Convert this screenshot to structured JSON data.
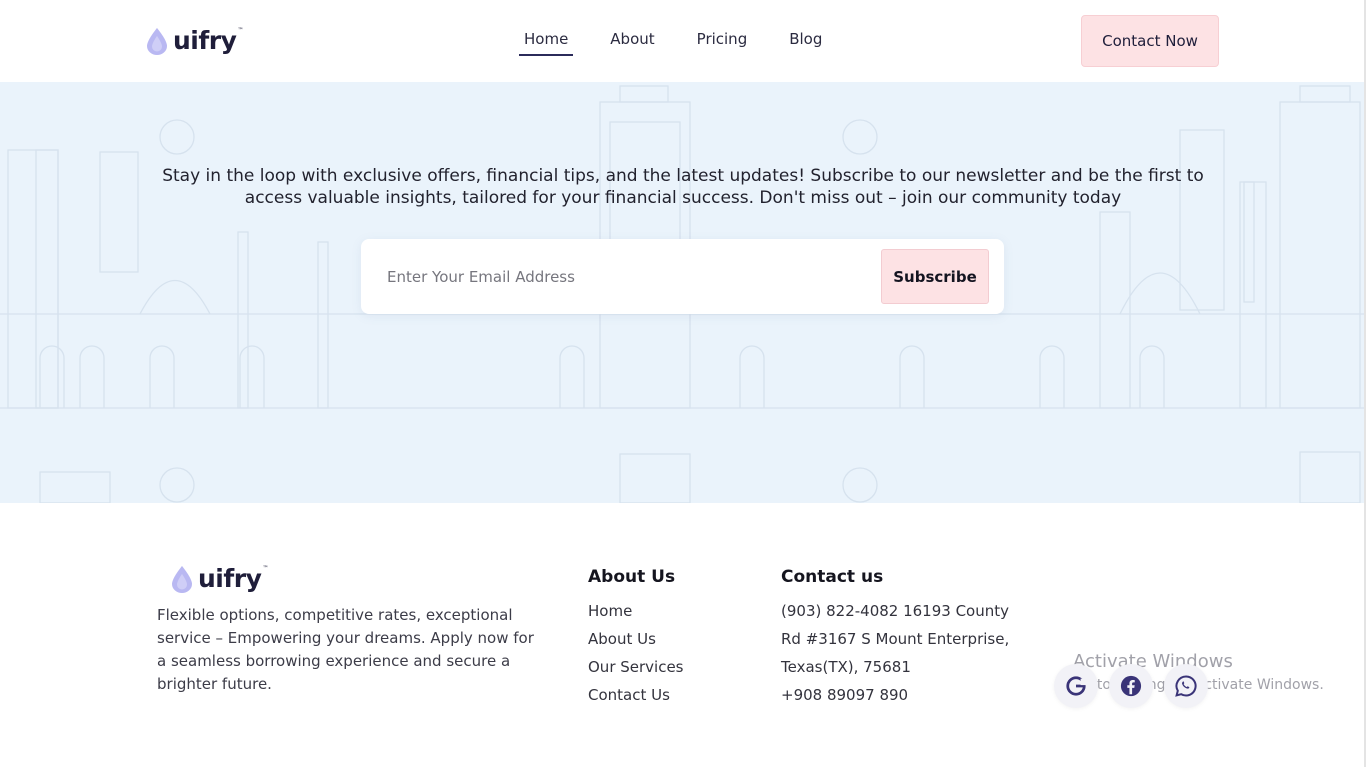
{
  "brand": {
    "name": "uifry",
    "tm": "™"
  },
  "nav": {
    "items": [
      {
        "label": "Home",
        "active": true
      },
      {
        "label": "About",
        "active": false
      },
      {
        "label": "Pricing",
        "active": false
      },
      {
        "label": "Blog",
        "active": false
      }
    ],
    "contact_button": "Contact Now"
  },
  "newsletter": {
    "line1": "Stay in the loop with exclusive offers, financial tips, and the latest updates! Subscribe to our newsletter and be the first to",
    "line2": "access valuable insights, tailored for your financial success. Don't miss out – join our community today",
    "email_placeholder": "Enter Your Email Address",
    "subscribe_label": "Subscribe"
  },
  "footer": {
    "description": "Flexible options, competitive rates, exceptional service – Empowering your dreams. Apply now for a seamless borrowing experience and secure a brighter future.",
    "about": {
      "title": "About Us",
      "links": [
        "Home",
        "About Us",
        "Our Services",
        "Contact Us"
      ]
    },
    "contact": {
      "title": "Contact us",
      "address": "(903) 822-4082 16193 County Rd #3167 S Mount Enterprise, Texas(TX), 75681",
      "phone": "+908 89097 890"
    },
    "social_icons": [
      "google-icon",
      "facebook-icon",
      "whatsapp-icon"
    ]
  },
  "watermark": {
    "title": "Activate Windows",
    "subtitle": "Go to Settings to activate Windows."
  },
  "colors": {
    "accent_pink": "#fde2e4",
    "newsletter_bg": "#eaf3fb",
    "logo_drop": "#b9b8f2",
    "dark_text": "#1f1e3a",
    "icon_color": "#3a3478"
  }
}
